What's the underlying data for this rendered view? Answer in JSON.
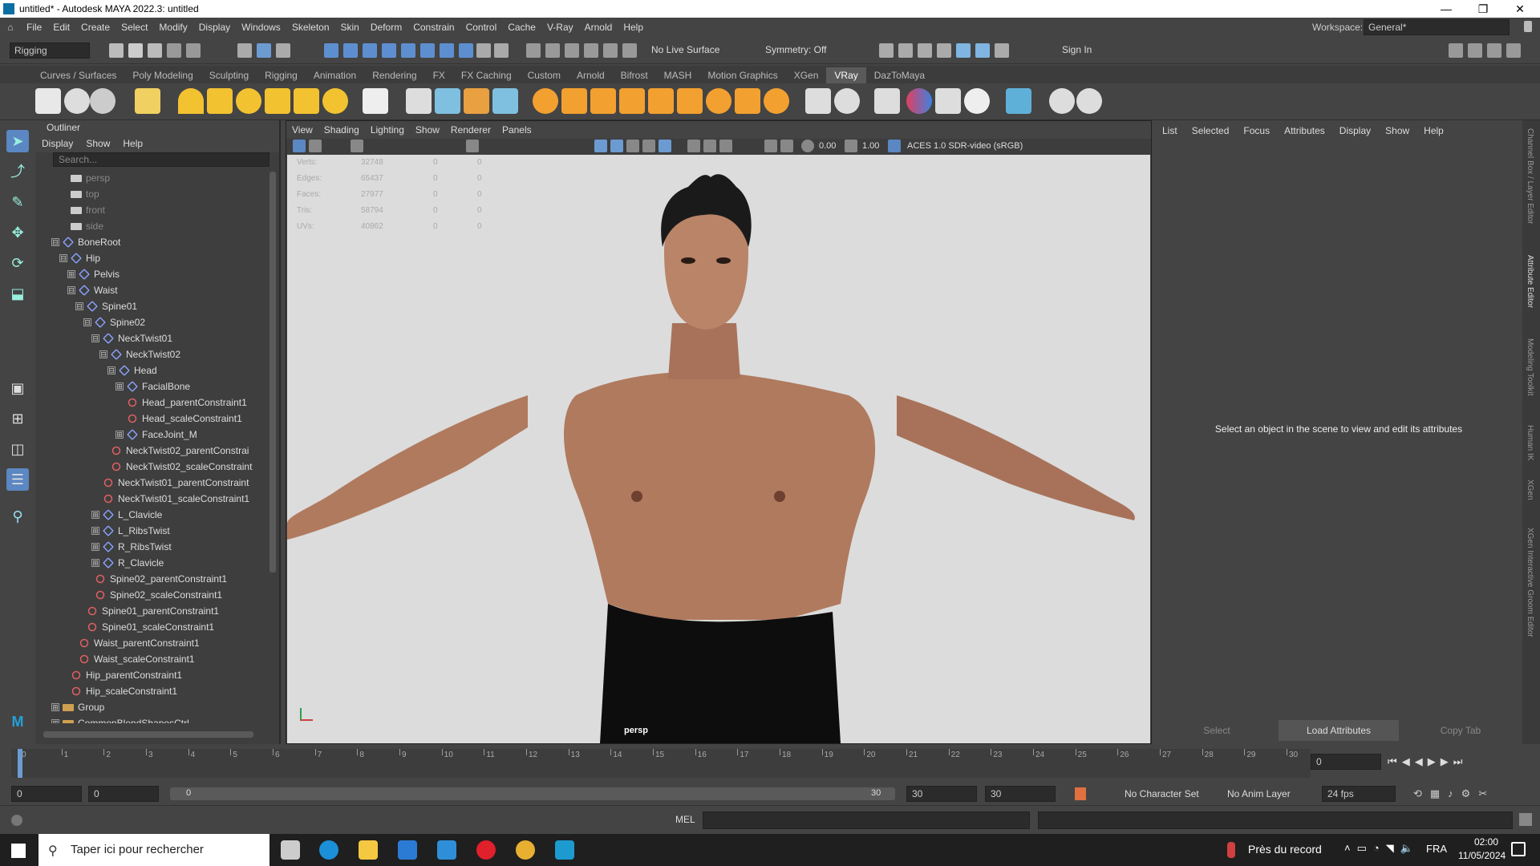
{
  "window": {
    "title": "untitled* - Autodesk MAYA 2022.3: untitled",
    "min": "—",
    "max": "❐",
    "close": "✕"
  },
  "menubar": [
    "File",
    "Edit",
    "Create",
    "Select",
    "Modify",
    "Display",
    "Windows",
    "Skeleton",
    "Skin",
    "Deform",
    "Constrain",
    "Control",
    "Cache",
    "V-Ray",
    "Arnold",
    "Help"
  ],
  "workspace": {
    "label": "Workspace:",
    "value": "General*"
  },
  "statusline": {
    "menuset": "Rigging",
    "live_surface": "No Live Surface",
    "symmetry": "Symmetry: Off",
    "sign_in": "Sign In"
  },
  "shelf_tabs": [
    "Curves / Surfaces",
    "Poly Modeling",
    "Sculpting",
    "Rigging",
    "Animation",
    "Rendering",
    "FX",
    "FX Caching",
    "Custom",
    "Arnold",
    "Bifrost",
    "MASH",
    "Motion Graphics",
    "XGen",
    "VRay",
    "DazToMaya"
  ],
  "outliner": {
    "title": "Outliner",
    "menu": [
      "Display",
      "Show",
      "Help"
    ],
    "search_placeholder": "Search...",
    "items": [
      {
        "label": "persp",
        "type": "cam",
        "dim": true
      },
      {
        "label": "top",
        "type": "cam",
        "dim": true
      },
      {
        "label": "front",
        "type": "cam",
        "dim": true
      },
      {
        "label": "side",
        "type": "cam",
        "dim": true
      },
      {
        "label": "BoneRoot",
        "type": "joint"
      },
      {
        "label": "Hip",
        "type": "joint"
      },
      {
        "label": "Pelvis",
        "type": "joint"
      },
      {
        "label": "Waist",
        "type": "joint"
      },
      {
        "label": "Spine01",
        "type": "joint"
      },
      {
        "label": "Spine02",
        "type": "joint"
      },
      {
        "label": "NeckTwist01",
        "type": "joint"
      },
      {
        "label": "NeckTwist02",
        "type": "joint"
      },
      {
        "label": "Head",
        "type": "joint"
      },
      {
        "label": "FacialBone",
        "type": "joint"
      },
      {
        "label": "Head_parentConstraint1",
        "type": "cons"
      },
      {
        "label": "Head_scaleConstraint1",
        "type": "cons"
      },
      {
        "label": "FaceJoint_M",
        "type": "joint"
      },
      {
        "label": "NeckTwist02_parentConstrai",
        "type": "cons"
      },
      {
        "label": "NeckTwist02_scaleConstraint",
        "type": "cons"
      },
      {
        "label": "NeckTwist01_parentConstraint",
        "type": "cons"
      },
      {
        "label": "NeckTwist01_scaleConstraint1",
        "type": "cons"
      },
      {
        "label": "L_Clavicle",
        "type": "joint"
      },
      {
        "label": "L_RibsTwist",
        "type": "joint"
      },
      {
        "label": "R_RibsTwist",
        "type": "joint"
      },
      {
        "label": "R_Clavicle",
        "type": "joint"
      },
      {
        "label": "Spine02_parentConstraint1",
        "type": "cons"
      },
      {
        "label": "Spine02_scaleConstraint1",
        "type": "cons"
      },
      {
        "label": "Spine01_parentConstraint1",
        "type": "cons"
      },
      {
        "label": "Spine01_scaleConstraint1",
        "type": "cons"
      },
      {
        "label": "Waist_parentConstraint1",
        "type": "cons"
      },
      {
        "label": "Waist_scaleConstraint1",
        "type": "cons"
      },
      {
        "label": "Hip_parentConstraint1",
        "type": "cons"
      },
      {
        "label": "Hip_scaleConstraint1",
        "type": "cons"
      },
      {
        "label": "Group",
        "type": "group"
      },
      {
        "label": "CommonBlendShapesCtrl",
        "type": "group"
      }
    ]
  },
  "viewport": {
    "menu": [
      "View",
      "Shading",
      "Lighting",
      "Show",
      "Renderer",
      "Panels"
    ],
    "exposure": "0.00",
    "gamma": "1.00",
    "color_space": "ACES 1.0 SDR-video (sRGB)",
    "camera_label": "persp",
    "hud": [
      {
        "label": "Verts:",
        "v": "32748",
        "a": "0",
        "b": "0"
      },
      {
        "label": "Edges:",
        "v": "65437",
        "a": "0",
        "b": "0"
      },
      {
        "label": "Faces:",
        "v": "27977",
        "a": "0",
        "b": "0"
      },
      {
        "label": "Tris:",
        "v": "58794",
        "a": "0",
        "b": "0"
      },
      {
        "label": "UVs:",
        "v": "40862",
        "a": "0",
        "b": "0"
      }
    ]
  },
  "attribute_editor": {
    "menu": [
      "List",
      "Selected",
      "Focus",
      "Attributes",
      "Display",
      "Show",
      "Help"
    ],
    "message": "Select an object in the scene to view and edit its attributes",
    "buttons": {
      "select": "Select",
      "load": "Load Attributes",
      "copy": "Copy Tab"
    }
  },
  "side_tabs": [
    "Channel Box / Layer Editor",
    "Attribute Editor",
    "Modeling Toolkit",
    "Human IK",
    "XGen",
    "XGen Interactive Groom Editor"
  ],
  "timeline": {
    "ticks": [
      "0",
      "1",
      "2",
      "3",
      "4",
      "5",
      "6",
      "7",
      "8",
      "9",
      "10",
      "11",
      "12",
      "13",
      "14",
      "15",
      "16",
      "17",
      "18",
      "19",
      "20",
      "21",
      "22",
      "23",
      "24",
      "25",
      "26",
      "27",
      "28",
      "29",
      "30"
    ],
    "current_frame": "0"
  },
  "range": {
    "start": "0",
    "anim_start": "0",
    "slider_start": "0",
    "slider_end": "30",
    "end": "30",
    "anim_end": "30",
    "char_set": "No Character Set",
    "anim_layer": "No Anim Layer",
    "fps": "24 fps"
  },
  "cmdline": {
    "lang": "MEL"
  },
  "taskbar": {
    "search": "Taper ici pour rechercher",
    "weather": "Près du record",
    "lang": "FRA",
    "time": "02:00",
    "date": "11/05/2024"
  },
  "colors": {
    "skin": "#b07a5e",
    "hair": "#1a1a1a",
    "shorts": "#0d0d0d",
    "viewport_bg": "#dcdcdc"
  }
}
